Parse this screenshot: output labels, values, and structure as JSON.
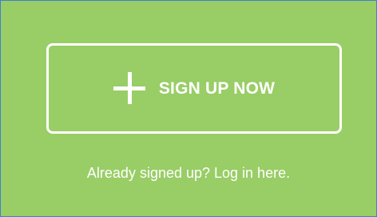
{
  "signup_button": {
    "icon": "plus-icon",
    "label": "SIGN UP NOW"
  },
  "login_link": {
    "text": "Already signed up? Log in here."
  },
  "colors": {
    "panel_background": "#99cd66",
    "panel_border": "#3f7fd3",
    "foreground": "#ffffff"
  }
}
